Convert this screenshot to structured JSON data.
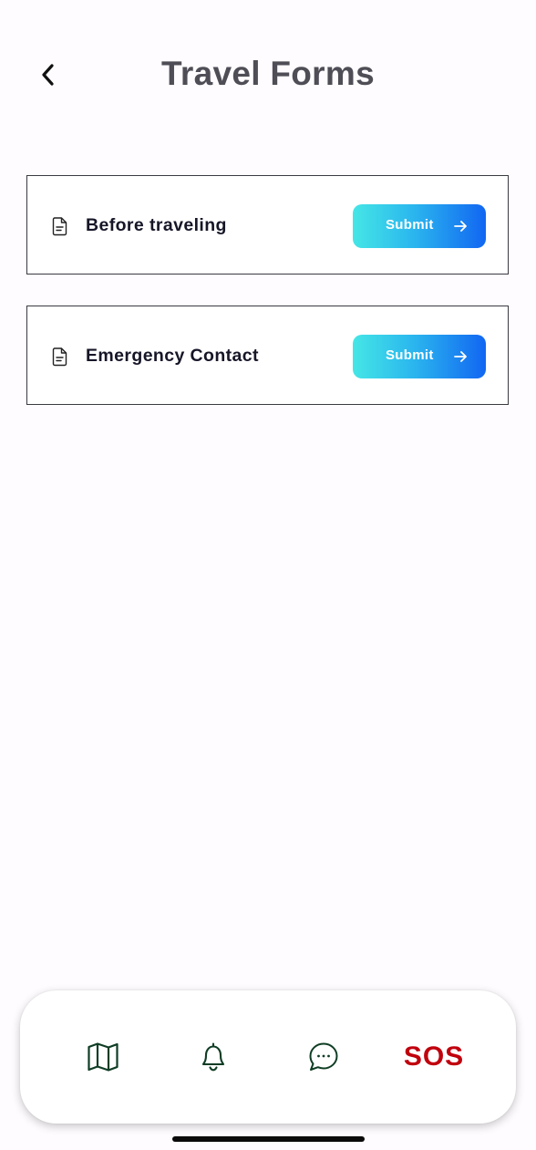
{
  "header": {
    "title": "Travel Forms",
    "back_icon": "chevron-left-icon"
  },
  "forms": [
    {
      "label": "Before traveling",
      "icon": "document-icon",
      "button_label": "Submit",
      "button_icon": "arrow-right-icon"
    },
    {
      "label": "Emergency Contact",
      "icon": "document-icon",
      "button_label": "Submit",
      "button_icon": "arrow-right-icon"
    }
  ],
  "bottom_nav": {
    "items": [
      {
        "icon": "map-icon"
      },
      {
        "icon": "bell-icon"
      },
      {
        "icon": "chat-icon"
      },
      {
        "label": "SOS"
      }
    ]
  },
  "colors": {
    "title": "#4f4d55",
    "button_gradient_start": "#45e6e6",
    "button_gradient_end": "#1266f2",
    "sos": "#c0000d",
    "nav_icon": "#0f3d24"
  }
}
